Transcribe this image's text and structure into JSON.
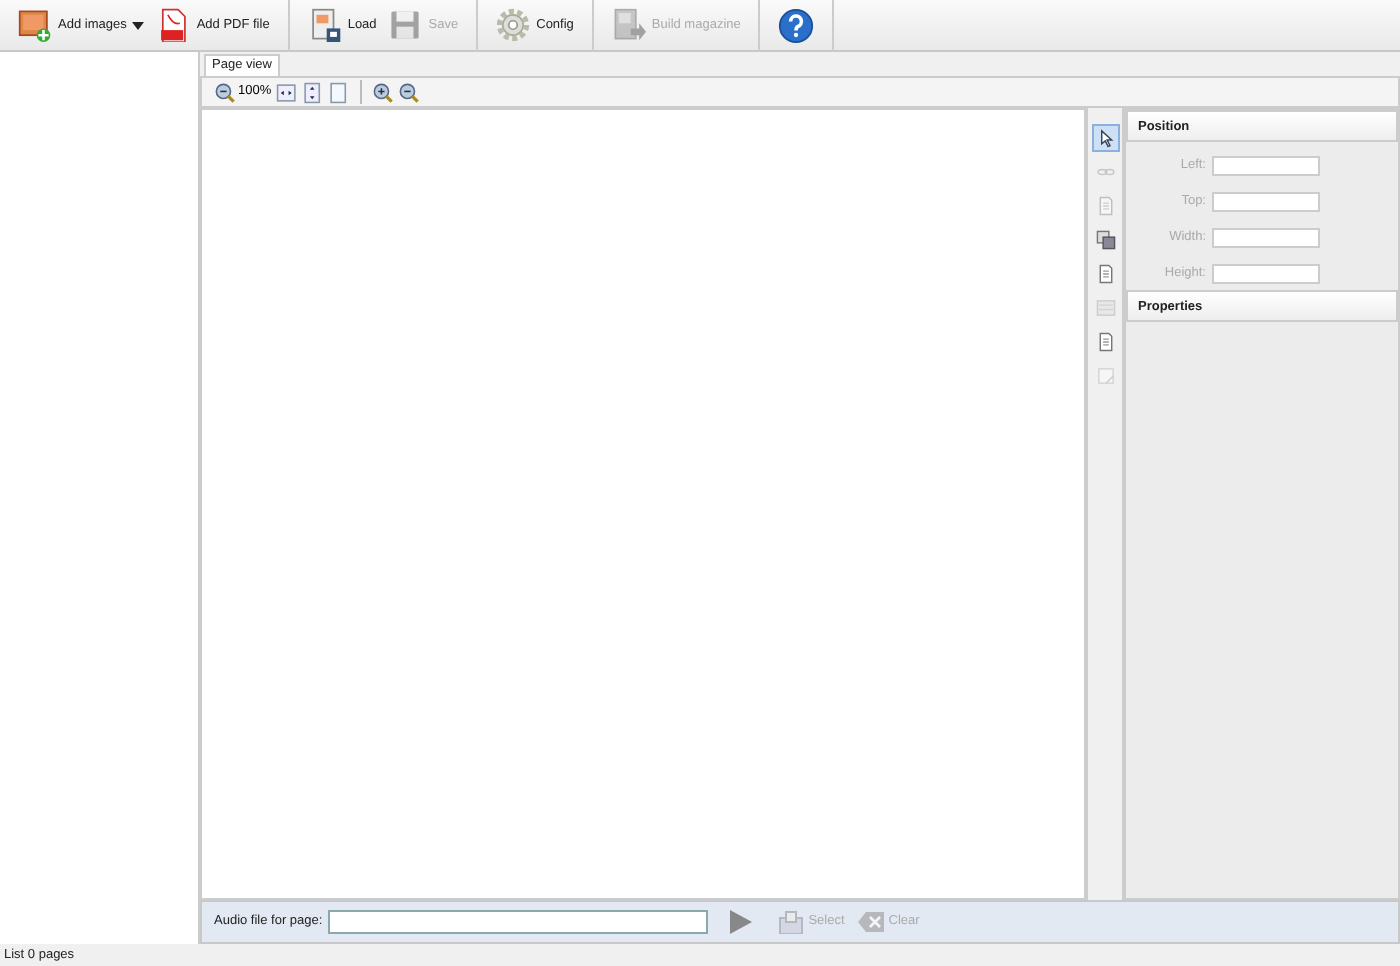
{
  "toolbar": {
    "groups": [
      [
        {
          "label": "Add images",
          "kind": "images",
          "disabled": false,
          "dropdown": true
        },
        {
          "label": "Add PDF file",
          "kind": "pdf",
          "disabled": false,
          "dropdown": false
        }
      ],
      [
        {
          "label": "Load",
          "kind": "load",
          "disabled": false,
          "dropdown": false
        },
        {
          "label": "Save",
          "kind": "save",
          "disabled": true,
          "dropdown": false
        }
      ],
      [
        {
          "label": "Config",
          "kind": "gear",
          "disabled": false,
          "dropdown": false
        }
      ],
      [
        {
          "label": "Build magazine",
          "kind": "build",
          "disabled": true,
          "dropdown": false
        }
      ],
      [
        {
          "kind": "help",
          "disabled": false,
          "dropdown": false
        }
      ]
    ]
  },
  "tabs": [
    {
      "label": "Page view",
      "selected": true
    }
  ],
  "view_toolbar": {
    "items": [
      {
        "kind": "zoomout",
        "label": "100%"
      },
      {
        "kind": "fitwidth"
      },
      {
        "kind": "fitheight"
      },
      {
        "kind": "page"
      },
      {
        "kind": "sep"
      },
      {
        "kind": "zoomin"
      },
      {
        "kind": "zoomout"
      }
    ]
  },
  "tools": [
    {
      "kind": "pointer",
      "selected": true,
      "disabled": false
    },
    {
      "kind": "link",
      "selected": false,
      "disabled": true
    },
    {
      "kind": "doc",
      "selected": false,
      "disabled": true
    },
    {
      "kind": "images",
      "selected": false,
      "disabled": false
    },
    {
      "kind": "doc",
      "selected": false,
      "disabled": false
    },
    {
      "kind": "lines",
      "selected": false,
      "disabled": true
    },
    {
      "kind": "doc",
      "selected": false,
      "disabled": false
    },
    {
      "kind": "crop",
      "selected": false,
      "disabled": true
    }
  ],
  "position": {
    "title": "Position",
    "fields": [
      {
        "label": "Left:",
        "disabled": true
      },
      {
        "label": "Top:",
        "disabled": true
      },
      {
        "label": "Width:",
        "disabled": true
      },
      {
        "label": "Height:",
        "disabled": true
      }
    ]
  },
  "properties": {
    "title": "Properties"
  },
  "audio": {
    "label": "Audio file for page:",
    "buttons": [
      {
        "label": "Select",
        "kind": "select",
        "disabled": true
      },
      {
        "label": "Clear",
        "kind": "clear",
        "disabled": true
      }
    ]
  },
  "status_bar": "List 0 pages"
}
